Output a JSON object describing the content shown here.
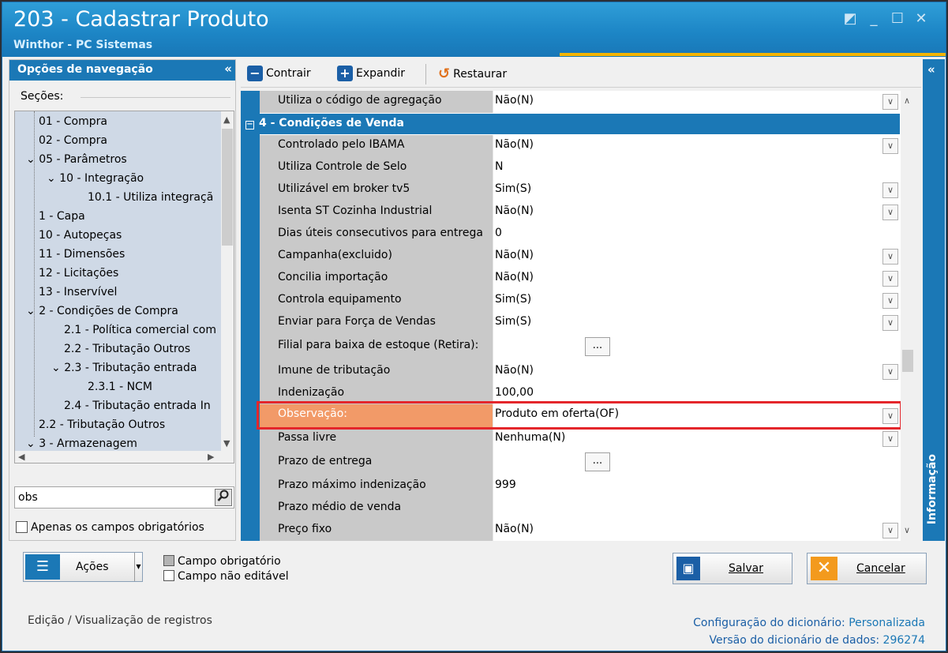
{
  "window": {
    "title": "203 - Cadastrar  Produto",
    "subtitle": "Winthor - PC Sistemas",
    "controls": {
      "minimize": "_",
      "maximize": "☐",
      "close": "✕",
      "restore_icon": "◩"
    }
  },
  "nav": {
    "header": "Opções de navegação",
    "collapse": "«",
    "sections_label": "Seções:",
    "tree": [
      "01 - Compra",
      "02 - Compra",
      "05 - Parâmetros",
      "10 - Integração",
      "10.1 - Utiliza integraçã",
      "1 - Capa",
      "10 - Autopeças",
      "11 - Dimensões",
      "12 - Licitações",
      "13 - Inservível",
      "2 - Condições de Compra",
      "2.1 - Política comercial com",
      "2.2 - Tributação Outros",
      "2.3 - Tributação entrada",
      "2.3.1 - NCM",
      "2.4 - Tributação entrada In",
      "2.2 - Tributação Outros",
      "3 - Armazenagem"
    ],
    "search_value": "obs",
    "only_required_label": "Apenas os campos obrigatórios"
  },
  "toolbar": {
    "collapse_label": "Contrair",
    "expand_label": "Expandir",
    "restore_label": "Restaurar"
  },
  "grid": {
    "rows_before": [
      {
        "label": "Utiliza o código de agregação",
        "value": "Não(N)",
        "control": "dropdown"
      }
    ],
    "section_title": "4 - Condições de Venda",
    "rows": [
      {
        "label": "Controlado pelo IBAMA",
        "value": "Não(N)",
        "control": "dropdown"
      },
      {
        "label": "Utiliza Controle de Selo",
        "value": "N",
        "control": "text"
      },
      {
        "label": "Utilizável em broker tv5",
        "value": "Sim(S)",
        "control": "dropdown"
      },
      {
        "label": "Isenta ST Cozinha Industrial",
        "value": "Não(N)",
        "control": "dropdown"
      },
      {
        "label": "Dias úteis consecutivos para entrega",
        "value": "0",
        "control": "text"
      },
      {
        "label": "Campanha(excluido)",
        "value": "Não(N)",
        "control": "dropdown"
      },
      {
        "label": "Concilia importação",
        "value": "Não(N)",
        "control": "dropdown"
      },
      {
        "label": "Controla equipamento",
        "value": "Sim(S)",
        "control": "dropdown"
      },
      {
        "label": "Enviar para Força de Vendas",
        "value": "Sim(S)",
        "control": "dropdown"
      },
      {
        "label": "Filial para baixa de estoque (Retira):",
        "value": "",
        "control": "ellipsis"
      },
      {
        "label": "Imune de tributação",
        "value": "Não(N)",
        "control": "dropdown"
      },
      {
        "label": "Indenização",
        "value": "100,00",
        "control": "text"
      },
      {
        "label": "Observação:",
        "value": "Produto em oferta(OF)",
        "control": "dropdown",
        "selected": true
      },
      {
        "label": "Passa livre",
        "value": "Nenhuma(N)",
        "control": "dropdown"
      },
      {
        "label": "Prazo de entrega",
        "value": "",
        "control": "ellipsis"
      },
      {
        "label": "Prazo máximo indenização",
        "value": "999",
        "control": "text"
      },
      {
        "label": "Prazo médio de venda",
        "value": "",
        "control": "text"
      },
      {
        "label": "Preço fixo",
        "value": "Não(N)",
        "control": "dropdown"
      }
    ]
  },
  "info_tab": {
    "label": "Informação",
    "collapse": "«"
  },
  "bottom": {
    "actions_label": "Ações",
    "legend_required": "Campo obrigatório",
    "legend_noneditable": "Campo não editável",
    "save_label": "Salvar",
    "cancel_label": "Cancelar",
    "status_left": "Edição / Visualização de registros",
    "dict_config_label": "Configuração do dicionário:",
    "dict_config_value": "Personalizada",
    "dict_version_label": "Versão do dicionário de dados:",
    "dict_version_value": "296274"
  },
  "colors": {
    "accent_blue": "#1b78b6",
    "selected_row": "#f29a68",
    "highlight_border": "#e4262b",
    "title_accent": "#f4b400"
  }
}
